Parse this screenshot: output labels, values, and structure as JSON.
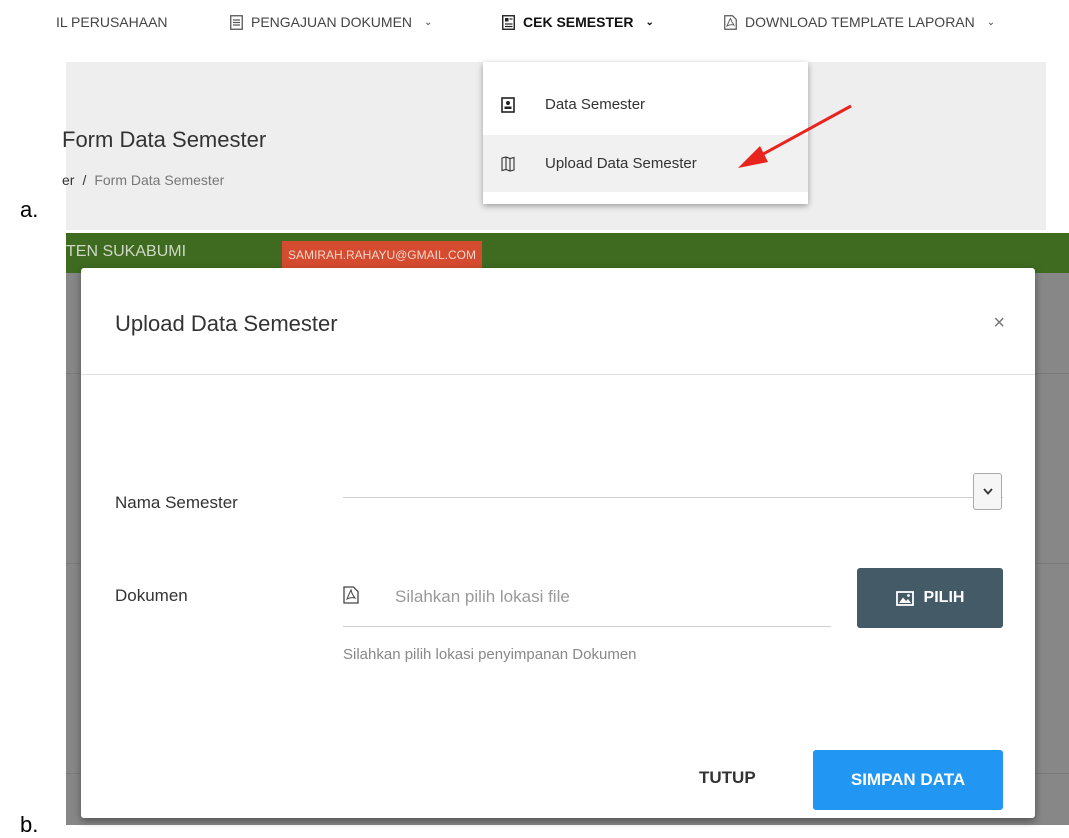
{
  "labels": {
    "panel_a": "a.",
    "panel_b": "b."
  },
  "topnav": {
    "items": [
      {
        "label": "IL PERUSAHAAN",
        "icon": "none"
      },
      {
        "label": "PENGAJUAN DOKUMEN",
        "icon": "document-icon",
        "chevron": "⌄"
      },
      {
        "label": "CEK SEMESTER",
        "icon": "id-card-icon",
        "chevron": "⌄",
        "active": true
      },
      {
        "label": "DOWNLOAD TEMPLATE LAPORAN",
        "icon": "pdf-icon",
        "chevron": "⌄"
      }
    ]
  },
  "page": {
    "title": "Form Data Semester",
    "breadcrumb_prev": "er",
    "breadcrumb_sep": "/",
    "breadcrumb_current": "Form Data Semester"
  },
  "dropdown": {
    "items": [
      {
        "label": "Data Semester",
        "icon": "contact-icon"
      },
      {
        "label": "Upload Data Semester",
        "icon": "map-icon",
        "highlighted": true
      }
    ]
  },
  "annotation": {
    "arrow_color": "#e8241f"
  },
  "header_b": {
    "location": "TEN SUKABUMI",
    "email": "SAMIRAH.RAHAYU@GMAIL.COM"
  },
  "modal": {
    "title": "Upload Data Semester",
    "close": "×",
    "nama_semester_label": "Nama Semester",
    "dokumen_label": "Dokumen",
    "file_placeholder": "Silahkan pilih lokasi file",
    "file_help": "Silahkan pilih lokasi penyimpanan Dokumen",
    "pilih_label": "PILIH",
    "tutup_label": "TUTUP",
    "simpan_label": "SIMPAN DATA"
  },
  "colors": {
    "green_header": "#3f6b21",
    "email_badge": "#d54b2f",
    "pilih_button": "#445a66",
    "simpan_button": "#2196f3"
  }
}
